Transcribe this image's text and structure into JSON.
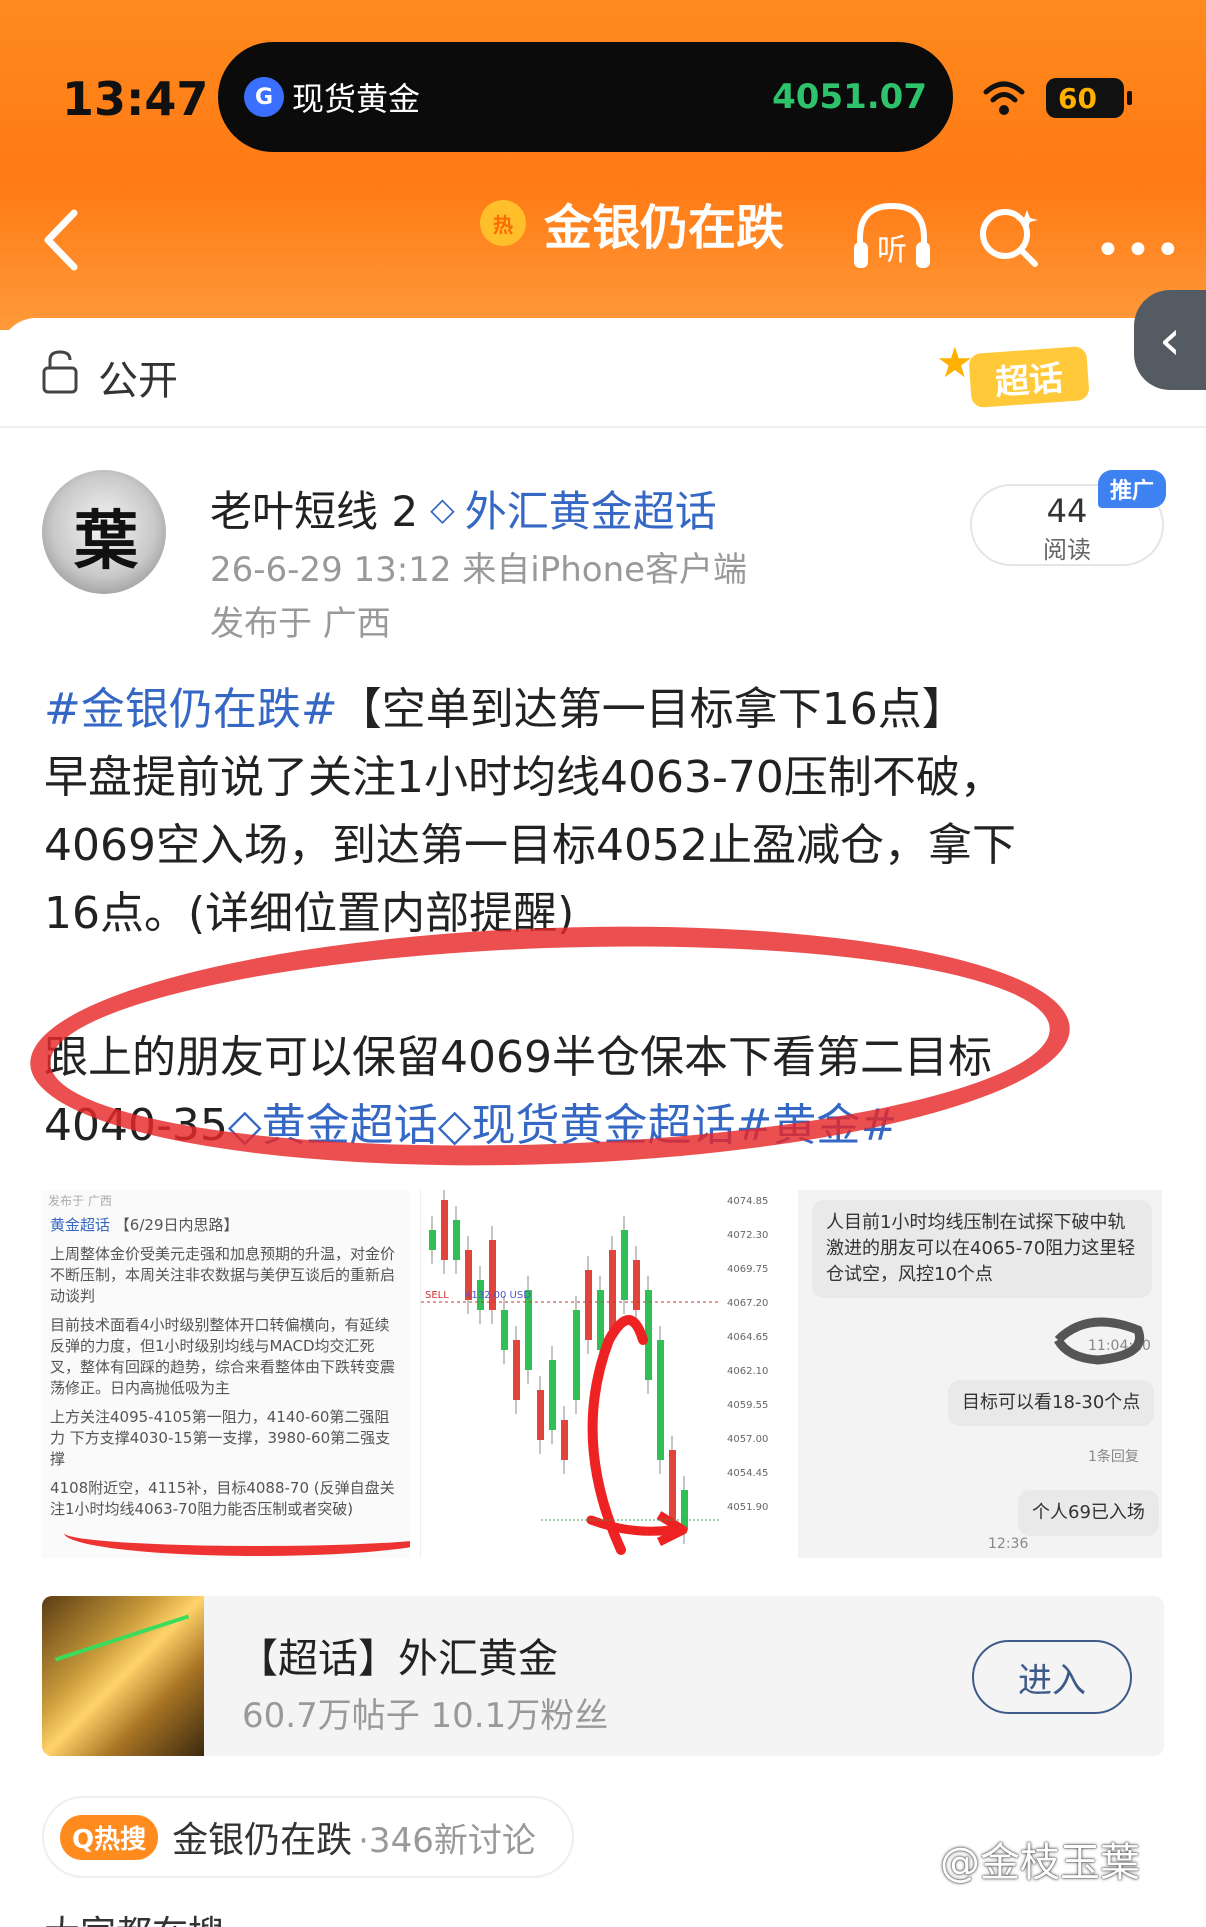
{
  "status_bar": {
    "time": "13:47",
    "island_label": "现货黄金",
    "island_price": "4051.07",
    "battery": "60"
  },
  "nav": {
    "hot_badge": "热",
    "title": "金银仍在跌",
    "listen_label": "听",
    "more": "•••"
  },
  "visibility": {
    "label": "公开",
    "sticker": "超话"
  },
  "post": {
    "author": "老叶短线 2",
    "topic": "外汇黄金超话",
    "avatar_char": "葉",
    "meta_time_source": "26-6-29 13:12  来自iPhone客户端",
    "meta_location": "发布于 广西",
    "read_count": "44",
    "read_label": "阅读",
    "promo": "推广",
    "para1": [
      {
        "hashtag": "#金银仍在跌#",
        "text": "【空单到达第一目标拿下16点】"
      },
      {
        "text": "早盘提前说了关注1小时均线4063-70压制不破，"
      },
      {
        "text": "4069空入场，到达第一目标4052止盈减仓，拿下"
      },
      {
        "text": "16点。(详细位置内部提醒)"
      }
    ],
    "para2_line1": "跟上的朋友可以保留4069半仓保本下看第二目标",
    "para2_line2_prefix": "4040-35",
    "para2_link1": "黄金超话",
    "para2_link2": "现货黄金超话",
    "para2_hashtag": "#黄金#"
  },
  "images": {
    "img1_header": "发布于 广西",
    "img1_topic": "黄金超话",
    "img1_title": "【6/29日内思路】",
    "img1_lines": [
      "上周整体金价受美元走强和加息预期的升温，对金价不断压制，本周关注非农数据与美伊互谈后的重新启动谈判",
      "目前技术面看4小时级别整体开口转偏横向，有延续反弹的力度，但1小时级别均线与MACD均交汇死叉，整体有回踩的趋势，综合来看整体由下跌转变震荡修正。日内高抛低吸为主",
      "上方关注4095-4105第一阻力，4140-60第二强阻力 下方支撑4030-15第一支撑，3980-60第二强支撑",
      "4108附近空，4115补，目标4088-70 (反弹自盘关注1小时均线4063-70阻力能否压制或者突破)"
    ],
    "chart_ticks": [
      "4074.85",
      "4072.30",
      "4069.75",
      "4067.20",
      "4064.65",
      "4062.10",
      "4059.55",
      "4057.00",
      "4054.45",
      "4051.90"
    ],
    "chart_sell_label": "SELL",
    "chart_sell_price": "4132.00 USD",
    "chat_msg1": "人目前1小时均线压制在试探下破中轨激进的朋友可以在4065-70阻力这里轻仓试空，风控10个点",
    "chat_time1": "11:04:20",
    "chat_msg2": "目标可以看18-30个点",
    "chat_reply": "1条回复",
    "chat_msg3": "个人69已入场",
    "chat_time2": "12:36"
  },
  "supertopic": {
    "title": "【超话】外汇黄金",
    "stats": "60.7万帖子  10.1万粉丝",
    "enter": "进入"
  },
  "hot_search": {
    "tag": "Q热搜",
    "text": "金银仍在跌",
    "count": "·346新讨论"
  },
  "watermark": "@金枝玉葉",
  "cut_text": "大家都在搜",
  "colors": {
    "header_orange": "#ff7a14",
    "link_blue": "#3567c4",
    "island_green": "#2ec36b",
    "annotation_red": "#e82828"
  }
}
